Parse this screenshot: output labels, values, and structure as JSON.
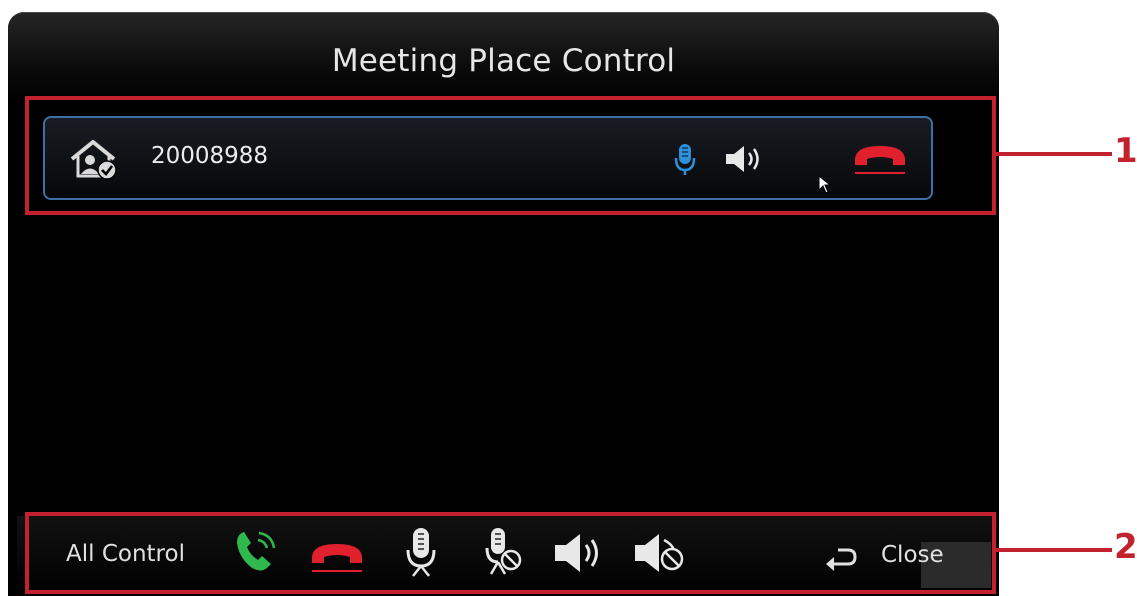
{
  "window": {
    "title": "Meeting Place Control"
  },
  "site": {
    "number": "20008988",
    "icons": [
      "meeting-place-check-icon",
      "microphone-icon",
      "speaker-icon",
      "hang-up-icon"
    ]
  },
  "all_control": {
    "label": "All Control",
    "icons": [
      "call-icon",
      "hang-up-icon",
      "microphone-icon",
      "mute-microphone-icon",
      "speaker-icon",
      "mute-speaker-icon"
    ],
    "close_label": "Close"
  },
  "annotations": {
    "row_marker": "1",
    "bottom_marker": "2"
  },
  "colors": {
    "annotation": "#c2222d",
    "row_border": "#3f6fa8",
    "call_green": "#2fb84b",
    "hangup_red": "#e0202c",
    "mic_blue": "#2f8fd8"
  }
}
